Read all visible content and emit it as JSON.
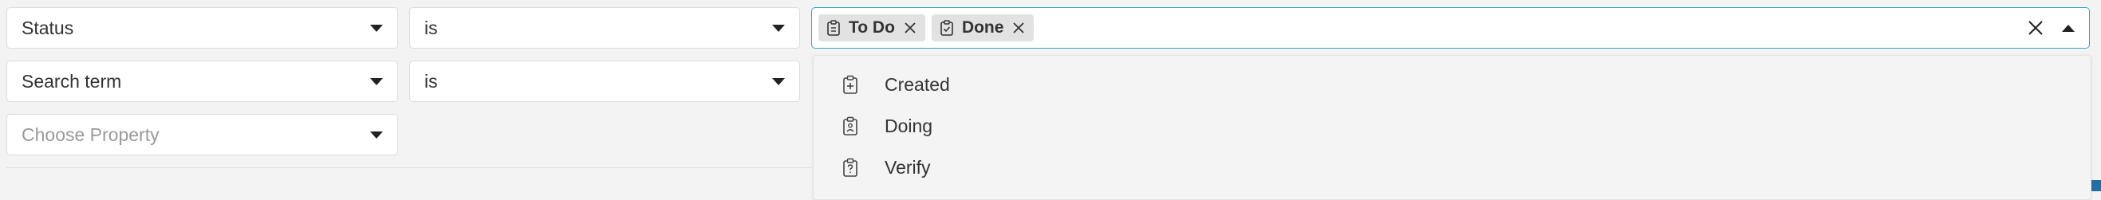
{
  "filters": [
    {
      "property": "Status",
      "operator": "is"
    },
    {
      "property": "Search term",
      "operator": "is"
    }
  ],
  "choose_property_placeholder": "Choose Property",
  "status_values": {
    "selected": [
      "To Do",
      "Done"
    ],
    "options": [
      "Created",
      "Doing",
      "Verify"
    ]
  },
  "colors": {
    "focus_border": "#3aa3b9",
    "chip_bg": "#e2e2e2",
    "accent_edge": "#1f6fa5"
  },
  "icons": {
    "status": "clipboard-icon",
    "remove": "close-icon",
    "clear": "close-icon",
    "expand": "caret-down-icon",
    "collapse": "caret-up-icon"
  }
}
